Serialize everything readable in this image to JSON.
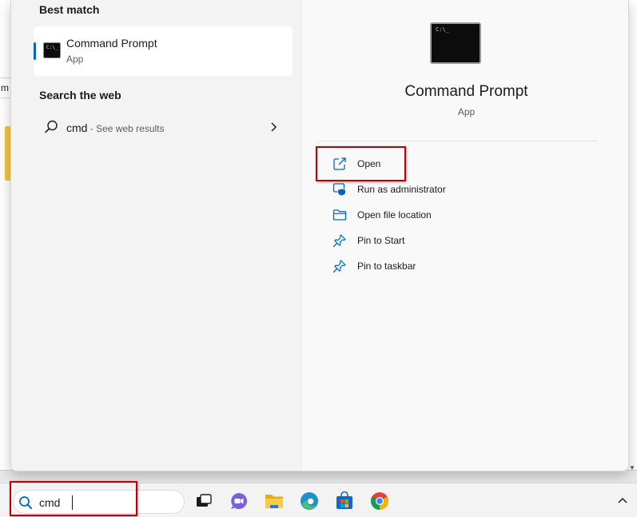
{
  "background": {
    "partial_text": "m"
  },
  "search_menu": {
    "best_match": {
      "heading": "Best match",
      "title": "Command Prompt",
      "subtitle": "App"
    },
    "web": {
      "heading": "Search the web",
      "query": "cmd",
      "suffix": " - See web results"
    },
    "detail": {
      "title": "Command Prompt",
      "subtitle": "App",
      "actions": [
        {
          "label": "Open",
          "icon": "open-external-icon"
        },
        {
          "label": "Run as administrator",
          "icon": "shield-icon"
        },
        {
          "label": "Open file location",
          "icon": "folder-icon"
        },
        {
          "label": "Pin to Start",
          "icon": "pin-icon"
        },
        {
          "label": "Pin to taskbar",
          "icon": "pin-icon"
        }
      ]
    }
  },
  "taskbar": {
    "search_value": "cmd",
    "icons": [
      "task-view-icon",
      "chat-icon",
      "file-explorer-icon",
      "edge-icon",
      "store-icon",
      "chrome-icon"
    ]
  },
  "colors": {
    "accent": "#0067c0",
    "highlight": "#c00000",
    "menu_bg": "#f3f3f3"
  }
}
